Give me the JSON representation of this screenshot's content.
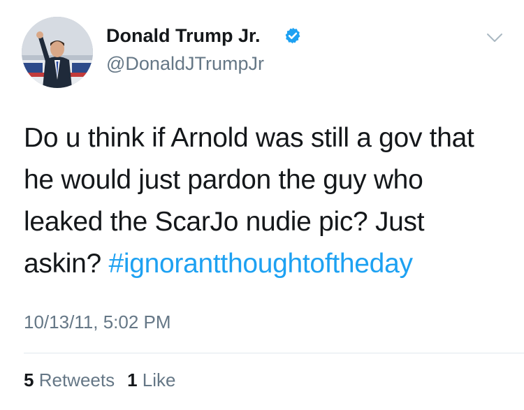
{
  "author": {
    "display_name": "Donald Trump Jr.",
    "handle": "@DonaldJTrumpJr",
    "verified": true
  },
  "tweet": {
    "text": "Do u think if Arnold was still a gov that he would just pardon the guy who leaked the ScarJo nudie pic? Just askin? ",
    "hashtag": "#ignorantthoughtoftheday",
    "timestamp": "10/13/11, 5:02 PM"
  },
  "stats": {
    "retweets_count": "5",
    "retweets_label": "Retweets",
    "likes_count": "1",
    "likes_label": "Like"
  },
  "icons": {
    "verified": "verified-badge-icon",
    "menu": "chevron-down-icon"
  },
  "colors": {
    "link": "#1da1f2",
    "secondary_text": "#657786",
    "primary_text": "#14171a",
    "divider": "#e1e8ed"
  }
}
